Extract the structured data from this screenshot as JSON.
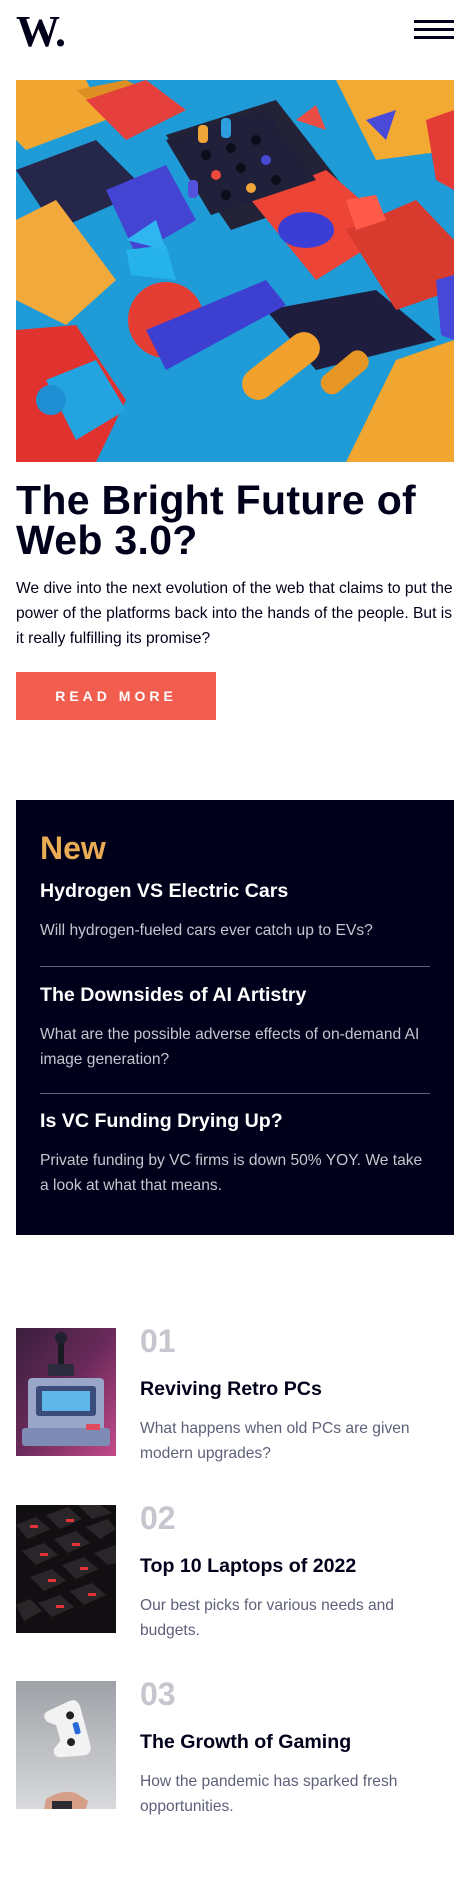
{
  "header": {
    "logo": "W.",
    "menu_icon": "hamburger-menu-icon"
  },
  "hero": {
    "image_icon": "colorful-3d-blocks-image",
    "title": "The Bright Future of Web 3.0?",
    "description": "We dive into the next evolution of the web that claims to put the power of the platforms back into the hands of the people. But is it really fulfilling its promise?",
    "button_label": "READ MORE"
  },
  "new": {
    "heading": "New",
    "items": [
      {
        "title": "Hydrogen VS Electric Cars",
        "description": "Will hydrogen-fueled cars ever catch up to EVs?"
      },
      {
        "title": "The Downsides of AI Artistry",
        "description": "What are the possible adverse effects of on-demand AI image generation?"
      },
      {
        "title": "Is VC Funding Drying Up?",
        "description": "Private funding by VC firms is down 50% YOY. We take a look at what that means."
      }
    ]
  },
  "ranked": {
    "items": [
      {
        "number": "01",
        "title": "Reviving Retro PCs",
        "description": "What happens when old PCs are given modern upgrades?",
        "image_icon": "retro-pc-image"
      },
      {
        "number": "02",
        "title": "Top 10 Laptops of 2022",
        "description": "Our best picks for various needs and budgets.",
        "image_icon": "laptop-keyboard-image"
      },
      {
        "number": "03",
        "title": "The Growth of Gaming",
        "description": "How the pandemic has sparked fresh opportunities.",
        "image_icon": "game-controller-image"
      }
    ]
  },
  "colors": {
    "accent_red": "#f15e50",
    "accent_orange": "#e9ab53",
    "dark_navy": "#00001a",
    "grayish_blue": "#5e607a",
    "grayish_light": "#c5c6ce"
  }
}
